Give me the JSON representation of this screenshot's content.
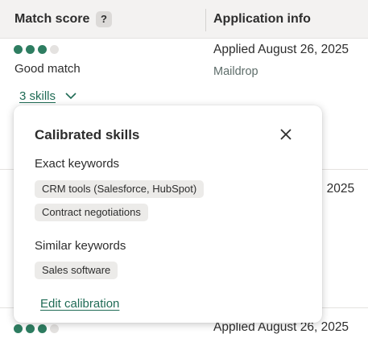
{
  "table": {
    "headers": {
      "match_score": "Match score",
      "help_icon": "?",
      "application_info": "Application info"
    },
    "rows": [
      {
        "score_dots_filled": 3,
        "score_dots_total": 4,
        "match_label": "Good match",
        "skills_link": "3 skills",
        "applied": "Applied August 26, 2025",
        "source": "Maildrop"
      },
      {
        "applied_partial": ", 2025"
      },
      {
        "score_dots_filled": 3,
        "score_dots_total": 4,
        "applied": "Applied August 26, 2025"
      }
    ]
  },
  "popover": {
    "title": "Calibrated skills",
    "close_icon": "close-icon",
    "exact_label": "Exact keywords",
    "exact_tags": [
      "CRM tools (Salesforce, HubSpot)",
      "Contract negotiations"
    ],
    "similar_label": "Similar keywords",
    "similar_tags": [
      "Sales software"
    ],
    "edit_link": "Edit calibration"
  },
  "colors": {
    "accent_green": "#2e7d61",
    "link_green": "#1f6b55",
    "dot_empty": "#e4e2e0"
  }
}
